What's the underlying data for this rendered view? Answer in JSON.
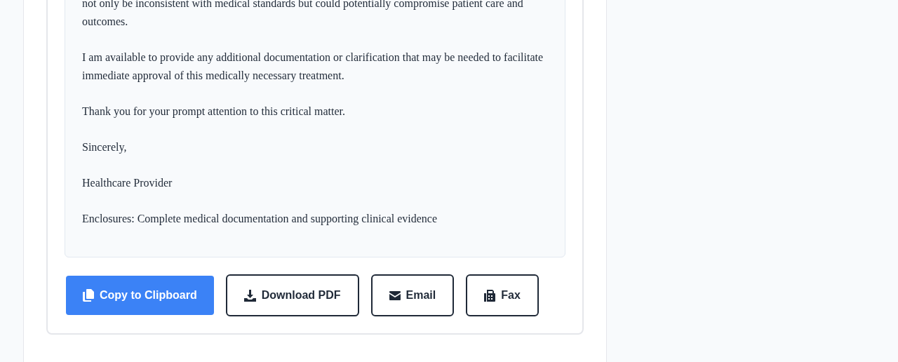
{
  "letter": {
    "paragraphs": [
      "not only be inconsistent with medical standards but could potentially compromise patient care and outcomes.",
      "I am available to provide any additional documentation or clarification that may be needed to facilitate immediate approval of this medically necessary treatment.",
      "Thank you for your prompt attention to this critical matter.",
      "Sincerely,",
      "Healthcare Provider",
      "Enclosures: Complete medical documentation and supporting clinical evidence"
    ]
  },
  "actions": [
    {
      "label": "Copy to Clipboard",
      "kind": "filled"
    },
    {
      "label": "Download PDF",
      "kind": "outline"
    },
    {
      "label": "Email",
      "kind": "outline"
    },
    {
      "label": "Fax",
      "kind": "outline"
    }
  ]
}
